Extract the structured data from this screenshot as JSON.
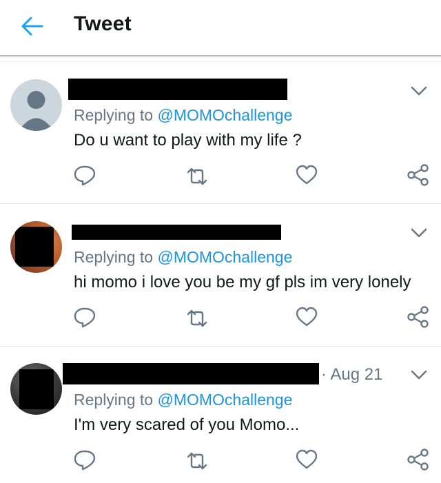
{
  "header": {
    "title": "Tweet",
    "back_icon": "back-arrow-icon",
    "accent": "#1da1f2"
  },
  "tweets": [
    {
      "avatar": "default-avatar",
      "replying_prefix": "Replying to",
      "handle": "@MOMOchallenge",
      "text": "Do u want to play with my life ?",
      "date": ""
    },
    {
      "avatar": "photo-avatar",
      "replying_prefix": "Replying to",
      "handle": "@MOMOchallenge",
      "text": "hi momo i love you be my gf pls im very lonely",
      "date": ""
    },
    {
      "avatar": "photo-avatar",
      "replying_prefix": "Replying to",
      "handle": "@MOMOchallenge",
      "text": "I'm very scared of you Momo...",
      "date": "· Aug 21"
    }
  ],
  "icons": {
    "reply": "reply-icon",
    "retweet": "retweet-icon",
    "like": "heart-icon",
    "share": "share-icon",
    "menu": "chevron-down-icon"
  },
  "colors": {
    "secondary_text": "#657786",
    "link": "#1b95e0",
    "divider": "#e1e8ed"
  }
}
